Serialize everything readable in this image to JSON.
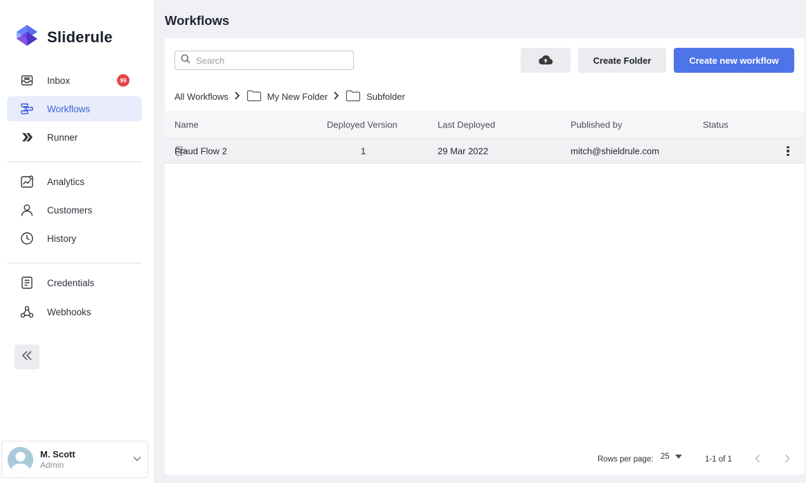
{
  "brand": {
    "name": "Sliderule"
  },
  "nav": {
    "inbox": {
      "label": "Inbox",
      "badge": "99"
    },
    "workflows": {
      "label": "Workflows"
    },
    "runner": {
      "label": "Runner"
    },
    "analytics": {
      "label": "Analytics"
    },
    "customers": {
      "label": "Customers"
    },
    "history": {
      "label": "History"
    },
    "credentials": {
      "label": "Credentials"
    },
    "webhooks": {
      "label": "Webhooks"
    }
  },
  "user": {
    "name": "M. Scott",
    "role": "Admin"
  },
  "page": {
    "title": "Workflows"
  },
  "toolbar": {
    "search_placeholder": "Search",
    "create_folder_label": "Create Folder",
    "create_workflow_label": "Create new workflow"
  },
  "breadcrumb": [
    "All Workflows",
    "My New Folder",
    "Subfolder"
  ],
  "table": {
    "columns": [
      "Name",
      "Deployed Version",
      "Last Deployed",
      "Published by",
      "Status"
    ],
    "rows": [
      {
        "name": "Fraud Flow 2",
        "version": "1",
        "last_deployed": "29 Mar 2022",
        "published_by": "mitch@shieldrule.com",
        "status": ""
      }
    ]
  },
  "pagination": {
    "rows_per_page_label": "Rows per page:",
    "rows_per_page": "25",
    "range": "1-1 of 1"
  },
  "colors": {
    "accent": "#4f74e8",
    "active_nav_bg": "#e8ecfb",
    "badge": "#e64646"
  }
}
